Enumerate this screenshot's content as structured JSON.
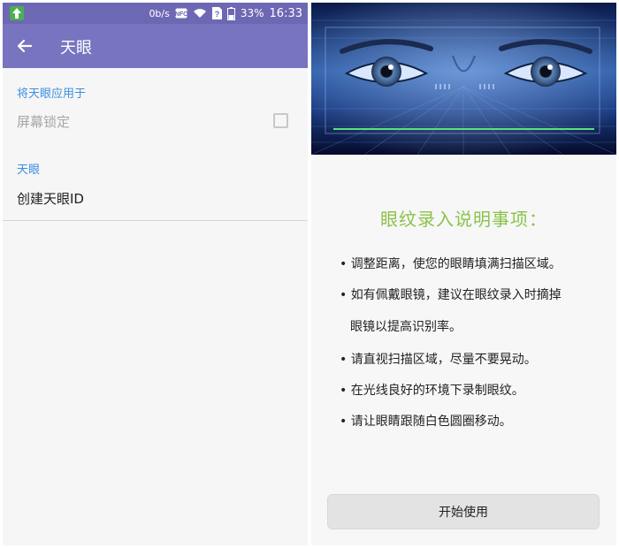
{
  "status_bar": {
    "speed": "0b/s",
    "nfc": "NFC",
    "sim": "?",
    "battery": "33%",
    "time": "16:33"
  },
  "left_screen": {
    "app_bar": {
      "title": "天眼",
      "back_icon": "arrow-left-icon"
    },
    "section1": {
      "header": "将天眼应用于",
      "item": {
        "label": "屏幕锁定",
        "checked": false
      }
    },
    "section2": {
      "header": "天眼",
      "item": {
        "label": "创建天眼ID"
      }
    }
  },
  "right_screen": {
    "instructions": {
      "title": "眼纹录入说明事项：",
      "items": [
        {
          "line1": "调整距离，使您的眼睛填满扫描区域。"
        },
        {
          "line1": "如有佩戴眼镜，建议在眼纹录入时摘掉",
          "line2": "眼镜以提高识别率。"
        },
        {
          "line1": "请直视扫描区域，尽量不要晃动。"
        },
        {
          "line1": "在光线良好的环境下录制眼纹。"
        },
        {
          "line1": "请让眼睛跟随白色圆圈移动。"
        }
      ],
      "bullet": "•"
    },
    "start_button": {
      "label": "开始使用"
    }
  },
  "colors": {
    "app_bar": "#7974c0",
    "status_bar": "#6d68b4",
    "section_header": "#3d8fe0",
    "title_green": "#8bc34a"
  }
}
